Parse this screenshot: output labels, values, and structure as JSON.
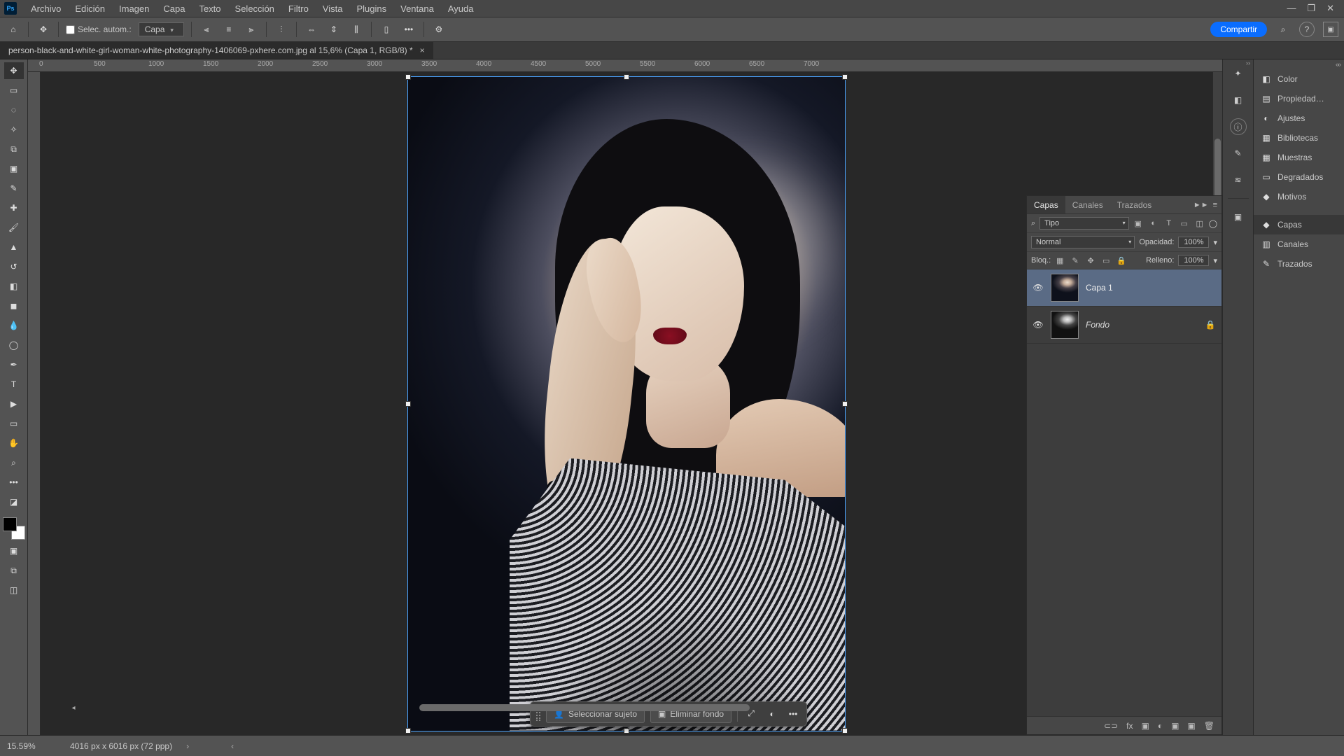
{
  "menubar": {
    "items": [
      "Archivo",
      "Edición",
      "Imagen",
      "Capa",
      "Texto",
      "Selección",
      "Filtro",
      "Vista",
      "Plugins",
      "Ventana",
      "Ayuda"
    ]
  },
  "window_controls": {
    "min": "—",
    "max": "❐",
    "close": "✕"
  },
  "optionsbar": {
    "home_icon": "⌂",
    "tool_icon": "✥",
    "auto_select_label": "Selec. autom.:",
    "target_dd": "Capa",
    "share_label": "Compartir",
    "search_icon": "⌕",
    "help_icon": "?"
  },
  "document": {
    "tab_label": "person-black-and-white-girl-woman-white-photography-1406069-pxhere.com.jpg al 15,6% (Capa 1, RGB/8) *",
    "close": "×"
  },
  "ruler_h": [
    "0",
    "500",
    "1000",
    "1500",
    "2000",
    "2500",
    "3000",
    "3500",
    "4000",
    "4500",
    "5000",
    "5500",
    "6000",
    "6500",
    "7000"
  ],
  "context_bar": {
    "select_subject": "Seleccionar sujeto",
    "remove_bg": "Eliminar fondo",
    "more": "•••"
  },
  "right_dock": {
    "icons": [
      "✦",
      "◧",
      "ⓘ",
      "✎",
      "≋",
      "—",
      "▣"
    ]
  },
  "far_panels": [
    "Color",
    "Propiedad…",
    "Ajustes",
    "Bibliotecas",
    "Muestras",
    "Degradados",
    "Motivos",
    "Capas",
    "Canales",
    "Trazados"
  ],
  "far_panel_icons": [
    "◧",
    "▤",
    "◐",
    "▦",
    "▦",
    "▭",
    "◆",
    "◆",
    "▥",
    "✎"
  ],
  "layers_panel": {
    "tabs": [
      "Capas",
      "Canales",
      "Trazados"
    ],
    "collapse": "►►",
    "menu": "≡",
    "filter_label": "Tipo",
    "filter_search_icon": "⌕",
    "filter_icons": [
      "▣",
      "◐",
      "T",
      "▭",
      "◫"
    ],
    "filter_toggle": "◯",
    "blend_mode": "Normal",
    "opacity_label": "Opacidad:",
    "opacity_value": "100%",
    "lock_label": "Bloq.:",
    "lock_icons": [
      "▦",
      "✎",
      "✥",
      "▭",
      "🔒"
    ],
    "fill_label": "Relleno:",
    "fill_value": "100%",
    "layers": [
      {
        "name": "Capa 1",
        "visible": true,
        "locked": false,
        "selected": true,
        "bw": false
      },
      {
        "name": "Fondo",
        "visible": true,
        "locked": true,
        "selected": false,
        "bw": true,
        "italic": true
      }
    ],
    "footer_icons": [
      "⊂⊃",
      "fx",
      "▣",
      "◐",
      "▣",
      "▣",
      "🗑"
    ]
  },
  "statusbar": {
    "zoom": "15.59%",
    "dims": "4016 px x 6016 px (72 ppp)",
    "arrow_l": "‹",
    "arrow_r": "›"
  }
}
